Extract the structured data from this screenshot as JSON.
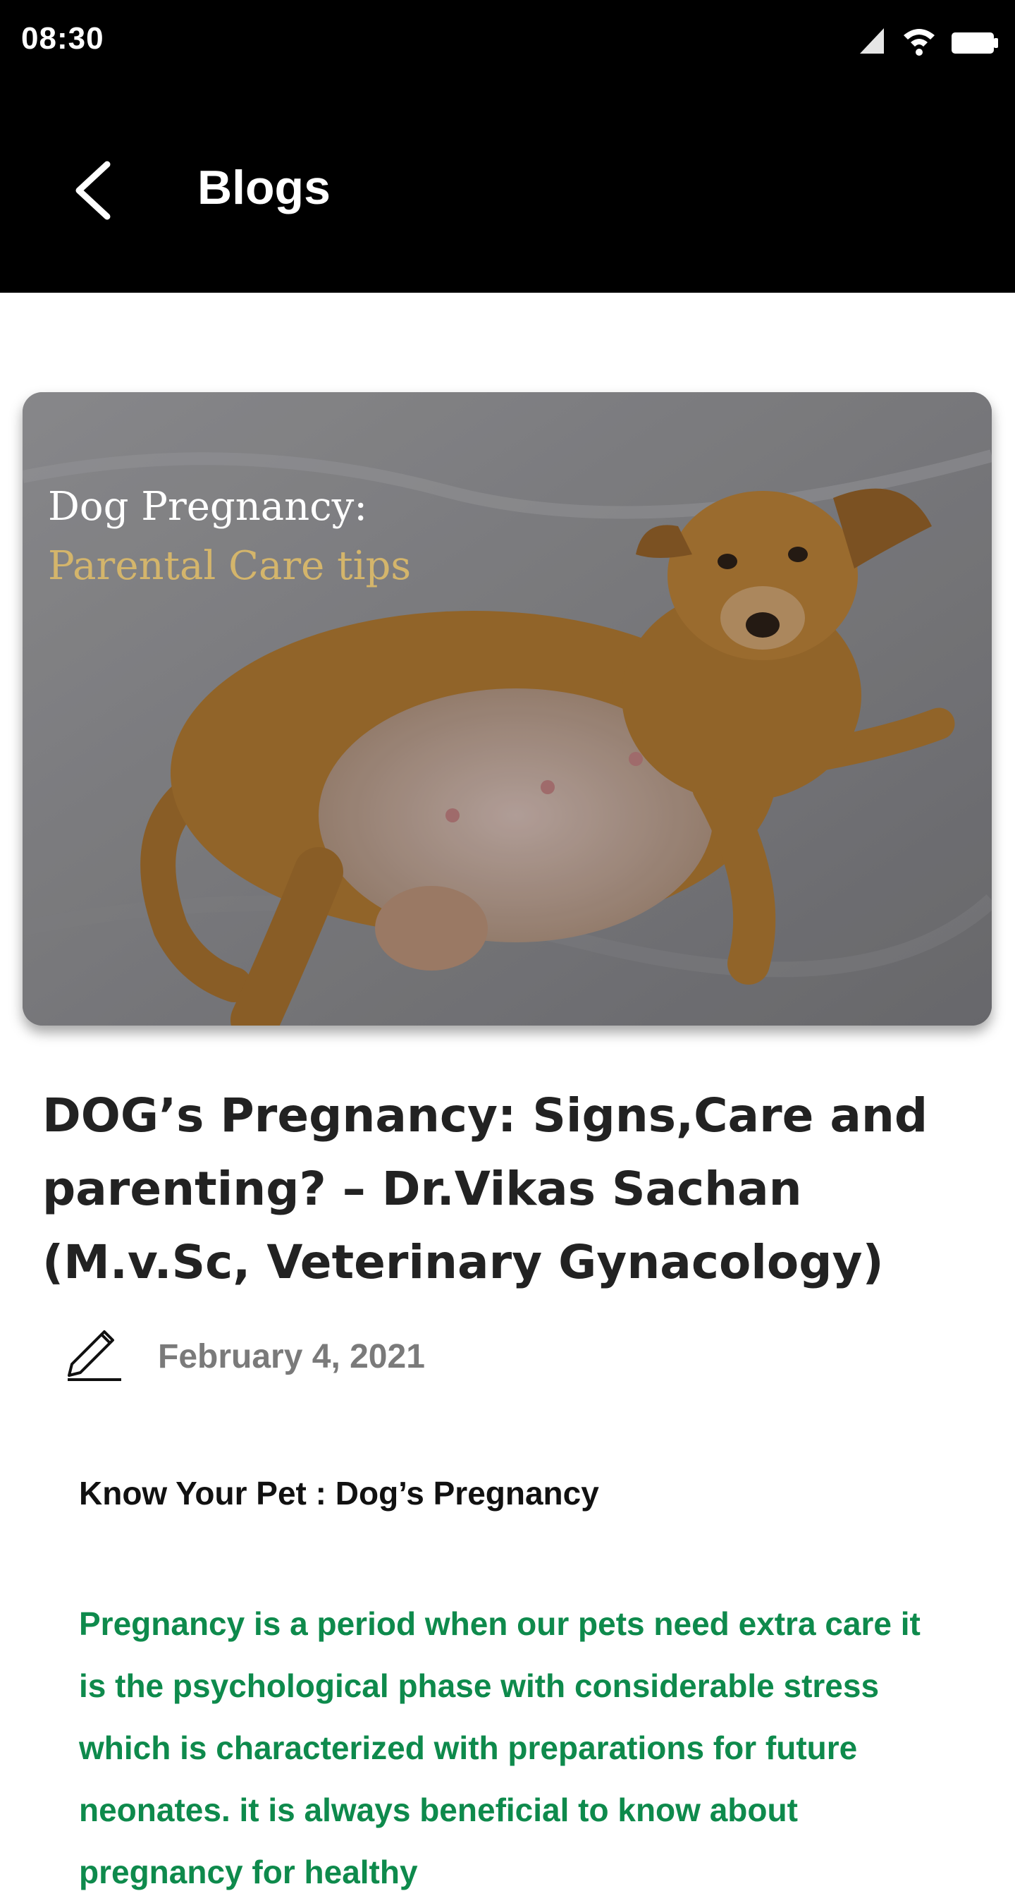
{
  "status_bar": {
    "time": "08:30"
  },
  "app_bar": {
    "title": "Blogs",
    "back_icon": "back-arrow-icon"
  },
  "hero": {
    "title_line1": "Dog Pregnancy:",
    "title_line2": "Parental Care tips",
    "accent_color": "#d4b56b"
  },
  "post": {
    "title": "DOG’s Pregnancy: Signs,Care and parenting? – Dr.Vikas Sachan (M.v.Sc, Veterinary Gynacology)",
    "date": "February 4, 2021",
    "author_icon": "pencil-icon",
    "subheading": "Know Your Pet : Dog’s Pregnancy",
    "body": "Pregnancy is a period when our pets need extra care it is the psychological phase with considerable stress which is characterized with preparations for future neonates. it is always beneficial to know about pregnancy for healthy",
    "body_color": "#0e8a4c"
  }
}
